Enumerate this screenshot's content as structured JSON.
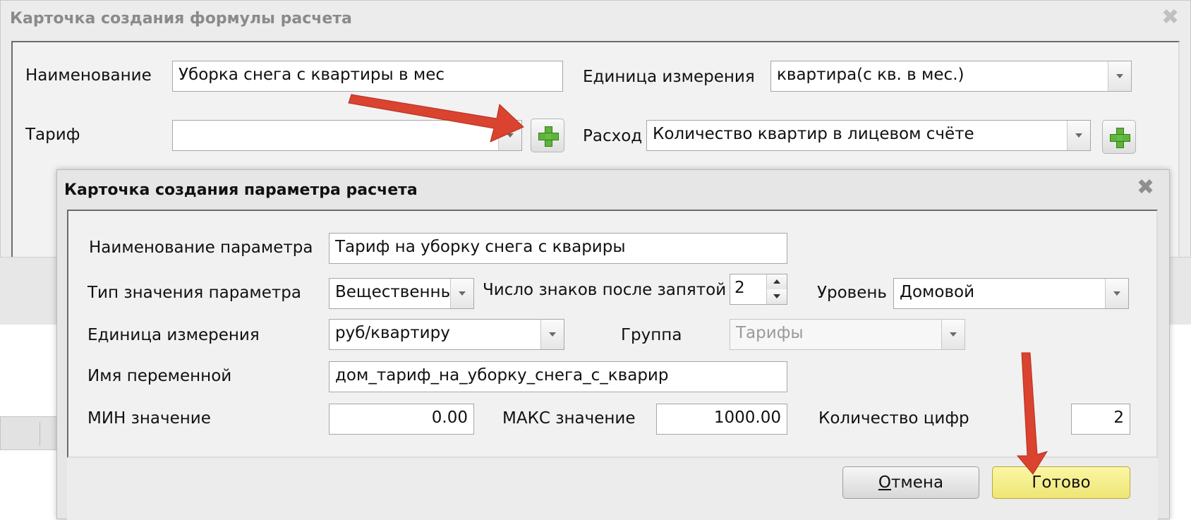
{
  "formula_card": {
    "title": "Карточка создания формулы расчета",
    "name_label": "Наименование",
    "name_value": "Уборка снега с квартиры в мес",
    "unit_label": "Единица измерения",
    "unit_value": "квартира(с кв. в мес.)",
    "tariff_label": "Тариф",
    "tariff_value": "",
    "expense_label": "Расход",
    "expense_value": "Количество квартир в лицевом счёте",
    "close_icon": "close-icon",
    "add_icon": "plus-icon"
  },
  "param_card": {
    "title": "Карточка создания параметра расчета",
    "param_name_label": "Наименование параметра",
    "param_name_value": "Тариф на уборку снега с квариры",
    "value_type_label": "Тип значения параметра",
    "value_type_value": "Вещественны",
    "decimals_label": "Число знаков после запятой",
    "decimals_value": "2",
    "level_label": "Уровень",
    "level_value": "Домовой",
    "unit_label": "Единица измерения",
    "unit_value": "руб/квартиру",
    "group_label": "Группа",
    "group_value": "Тарифы",
    "var_name_label": "Имя переменной",
    "var_name_value": "дом_тариф_на_уборку_снега_с_кварир",
    "min_label": "МИН значение",
    "min_value": "0.00",
    "max_label": "МАКС значение",
    "max_value": "1000.00",
    "digits_label": "Количество цифр",
    "digits_value": "2",
    "cancel_label_underlined": "О",
    "cancel_label_rest": "тмена",
    "ok_label": "Готово",
    "close_icon": "close-icon"
  },
  "colors": {
    "annotation_arrow": "#d9432f",
    "ok_button": "#f4ee8c",
    "add_icon": "#5fb33a"
  }
}
